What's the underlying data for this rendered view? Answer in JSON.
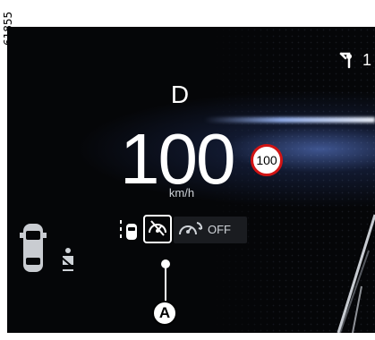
{
  "figure": {
    "ref_code": "61855",
    "callout_label": "A"
  },
  "cluster": {
    "gear": "D",
    "speed": "100",
    "unit": "km/h",
    "speed_limit": "100",
    "nav_distance": "1",
    "adas": {
      "off_label": "OFF"
    }
  },
  "colors": {
    "background": "#050608",
    "speed_limit_ring": "#d21414",
    "accent_glow": "#a0beff"
  },
  "icons": {
    "navigation": "turn-arrow-icon",
    "lane_assist": "lane-car-icon",
    "speed_limiter": "speedometer-limit-icon",
    "cruise_control": "speedometer-cruise-icon",
    "vehicle": "car-top-view-icon",
    "seatbelt": "seatbelt-icon"
  }
}
